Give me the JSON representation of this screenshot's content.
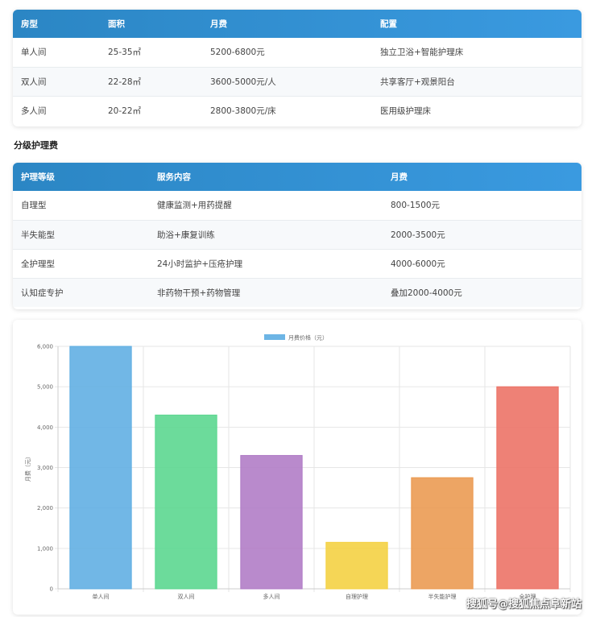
{
  "room_table": {
    "headers": [
      "房型",
      "面积",
      "月费",
      "配置"
    ],
    "rows": [
      [
        "单人间",
        "25-35㎡",
        "5200-6800元",
        "独立卫浴+智能护理床"
      ],
      [
        "双人间",
        "22-28㎡",
        "3600-5000元/人",
        "共享客厅+观景阳台"
      ],
      [
        "多人间",
        "20-22㎡",
        "2800-3800元/床",
        "医用级护理床"
      ]
    ]
  },
  "care_section_title": "分级护理费",
  "care_table": {
    "headers": [
      "护理等级",
      "服务内容",
      "月费"
    ],
    "rows": [
      [
        "自理型",
        "健康监测+用药提醒",
        "800-1500元"
      ],
      [
        "半失能型",
        "助浴+康复训练",
        "2000-3500元"
      ],
      [
        "全护理型",
        "24小时监护+压疮护理",
        "4000-6000元"
      ],
      [
        "认知症专护",
        "非药物干预+药物管理",
        "叠加2000-4000元"
      ]
    ]
  },
  "chart_data": {
    "type": "bar",
    "categories": [
      "单人间",
      "双人间",
      "多人间",
      "自理护理",
      "半失能护理",
      "全护理"
    ],
    "series": [
      {
        "name": "月费价格（元）",
        "values": [
          6000,
          4300,
          3300,
          1150,
          2750,
          5000
        ]
      }
    ],
    "bar_colors": [
      "#5dade2",
      "#58d68d",
      "#af7ac5",
      "#f4d03f",
      "#eb984e",
      "#ec7063"
    ],
    "legend_color": "#5dade2",
    "ylabel": "月费（元）",
    "ylim": [
      0,
      6000
    ],
    "yticks": [
      0,
      1000,
      2000,
      3000,
      4000,
      5000,
      6000
    ],
    "ytick_labels": [
      "0",
      "1,000",
      "2,000",
      "3,000",
      "4,000",
      "5,000",
      "6,000"
    ],
    "grid": true,
    "legend_position": "top-center"
  },
  "watermark": "搜狐号@搜狐焦点阜新站"
}
